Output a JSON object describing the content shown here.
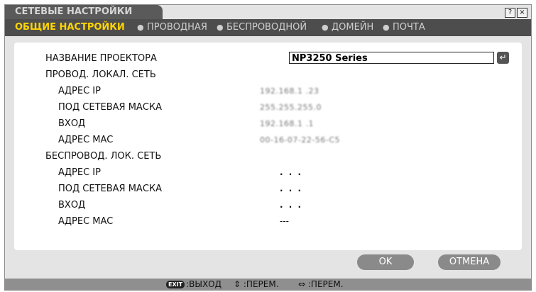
{
  "window": {
    "title": "СЕТЕВЫЕ НАСТРОЙКИ",
    "help_label": "?",
    "close_label": "×"
  },
  "tabs": {
    "active": "ОБЩИЕ НАСТРОЙКИ",
    "wired": "ПРОВОДНАЯ",
    "wireless": "БЕСПРОВОДНОЙ",
    "domain": "ДОМЕЙН",
    "mail": "ПОЧТА",
    "separator": "●"
  },
  "form": {
    "projector_name_label": "НАЗВАНИЕ ПРОЕКТОРА",
    "projector_name_value": "NP3250 Series",
    "enter_glyph": "↵",
    "wired_section_label": "ПРОВОД. ЛОКАЛ. СЕТЬ",
    "wired": {
      "ip_label": "АДРЕС IP",
      "ip_value": "192.168.1 .23",
      "mask_label": "ПОД СЕТЕВАЯ МАСКА",
      "mask_value": "255.255.255.0",
      "gateway_label": "ВХОД",
      "gateway_value": "192.168.1 .1",
      "mac_label": "АДРЕС MAC",
      "mac_value": "00-16-07-22-56-C5"
    },
    "wireless_section_label": "БЕСПРОВОД. ЛОК. СЕТЬ",
    "wireless": {
      "ip_label": "АДРЕС IP",
      "ip_value": ". . .",
      "mask_label": "ПОД СЕТЕВАЯ МАСКА",
      "mask_value": ". . .",
      "gateway_label": "ВХОД",
      "gateway_value": ". . .",
      "mac_label": "АДРЕС MAC",
      "mac_value": "---"
    }
  },
  "buttons": {
    "ok": "OK",
    "cancel": "ОТМЕНА"
  },
  "footer": {
    "exit_badge": "EXIT",
    "exit_label": ":ВЫХОД",
    "move_glyph": "⇕",
    "move_label": ":ПЕРЕМ.",
    "adjust_glyph": "⇔",
    "adjust_label": ":ПЕРЕМ."
  },
  "colors": {
    "active_tab": "#ffd500",
    "header_bg": "#4d4d4d",
    "button_bg": "#8a8a8a"
  }
}
